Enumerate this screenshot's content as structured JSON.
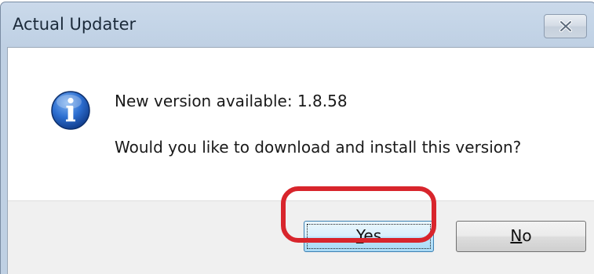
{
  "window": {
    "title": "Actual Updater"
  },
  "message": {
    "line1": "New version available: 1.8.58",
    "line2": "Would you like to download and install this version?"
  },
  "buttons": {
    "yes": {
      "mnemonic": "Y",
      "rest": "es"
    },
    "no": {
      "mnemonic": "N",
      "rest": "o"
    }
  },
  "icons": {
    "info": "info-icon",
    "close": "close-icon"
  },
  "colors": {
    "highlight": "#d8252c",
    "titlebar": "#c4d4e7",
    "button_area": "#f0f0f0"
  }
}
